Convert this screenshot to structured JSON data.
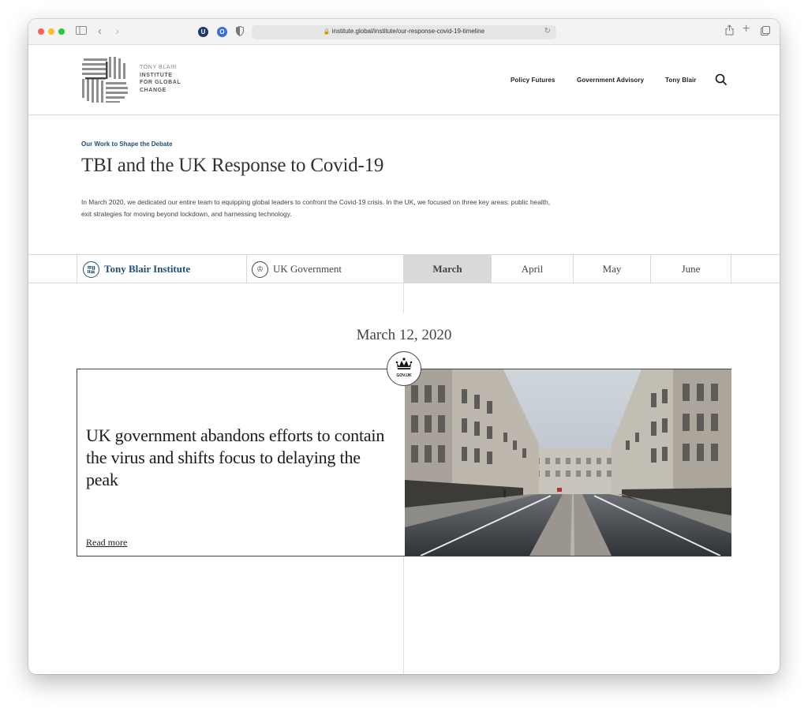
{
  "browser": {
    "url": "institute.global/institute/our-response-covid-19-timeline",
    "lock_glyph": "🔒",
    "reload_glyph": "↻",
    "extensions": [
      "U",
      "O"
    ]
  },
  "site": {
    "logo_lines": [
      "TONY BLAIR",
      "INSTITUTE",
      "FOR GLOBAL",
      "CHANGE"
    ],
    "nav": [
      "Policy Futures",
      "Government Advisory",
      "Tony Blair"
    ]
  },
  "intro": {
    "eyebrow": "Our Work to Shape the Debate",
    "title": "TBI and the UK Response to Covid-19",
    "body": "In March 2020, we dedicated our entire team to equipping global leaders to confront the Covid-19 crisis. In the UK, we focused on three key areas: public health, exit strategies for moving beyond lockdown, and harnessing technology."
  },
  "tabs": {
    "tbi": "Tony Blair Institute",
    "uk_gov": "UK Government",
    "months": [
      "March",
      "April",
      "May",
      "June"
    ],
    "active_month": "March"
  },
  "timeline": {
    "date": "March 12, 2020",
    "badge_label": "GOV.UK",
    "card_title": "UK government abandons efforts to contain the virus and shifts focus to delaying the peak",
    "read_more": "Read more"
  },
  "colors": {
    "accent_blue": "#1d4f78",
    "active_tab_bg": "#d9d9d9"
  }
}
